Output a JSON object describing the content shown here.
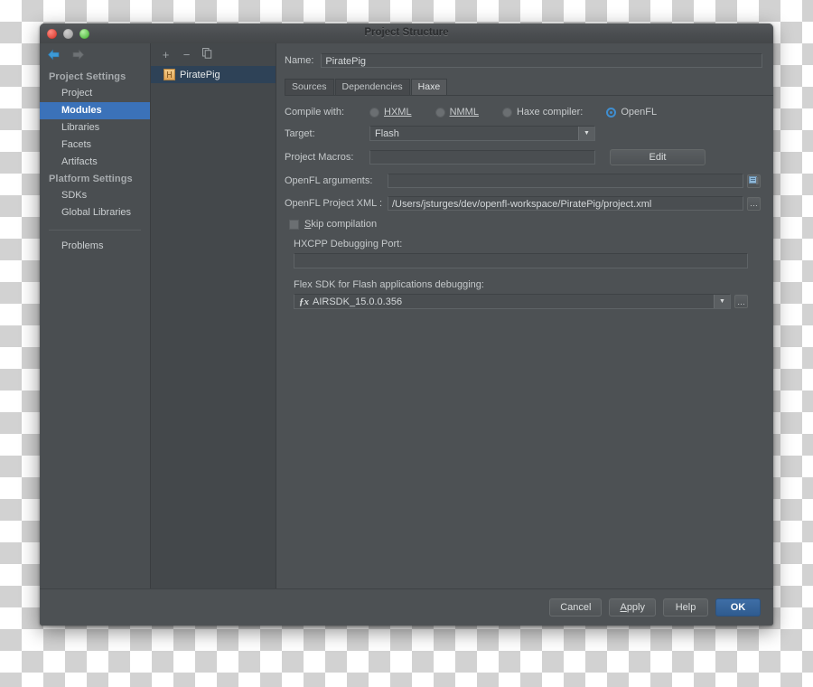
{
  "window": {
    "title": "Project Structure",
    "traffic_lights": [
      "close-red",
      "minimize-gray",
      "zoom-green"
    ]
  },
  "navigation": {
    "back_icon": "arrow-left-icon",
    "forward_icon": "arrow-right-icon"
  },
  "sidebar": {
    "groups": [
      {
        "label": "Project Settings",
        "items": [
          {
            "label": "Project",
            "selected": false
          },
          {
            "label": "Modules",
            "selected": true
          },
          {
            "label": "Libraries",
            "selected": false
          },
          {
            "label": "Facets",
            "selected": false
          },
          {
            "label": "Artifacts",
            "selected": false
          }
        ]
      },
      {
        "label": "Platform Settings",
        "items": [
          {
            "label": "SDKs",
            "selected": false
          },
          {
            "label": "Global Libraries",
            "selected": false
          }
        ]
      }
    ],
    "footer_items": [
      {
        "label": "Problems",
        "selected": false
      }
    ],
    "selected_color": "#3b72b9"
  },
  "module_pane": {
    "toolbar": {
      "add_label": "+",
      "remove_label": "−",
      "copy_label": "❐"
    },
    "modules": [
      {
        "name": "PiratePig",
        "selected": true
      }
    ]
  },
  "editor": {
    "name_label": "Name:",
    "name_value": "PiratePig",
    "tabs": [
      {
        "label": "Sources",
        "active": false
      },
      {
        "label": "Dependencies",
        "active": false
      },
      {
        "label": "Haxe",
        "active": true
      }
    ],
    "compile_with": {
      "label": "Compile with:",
      "options": [
        {
          "label": "HXML",
          "mnemonic": "H",
          "selected": false
        },
        {
          "label": "NMML",
          "mnemonic": "N",
          "selected": false
        },
        {
          "label": "Haxe compiler:",
          "mnemonic": "",
          "selected": false
        },
        {
          "label": "OpenFL",
          "mnemonic": "",
          "selected": true
        }
      ]
    },
    "target": {
      "label": "Target:",
      "value": "Flash",
      "arrow_icon": "chevron-down-icon"
    },
    "project_macros": {
      "label": "Project Macros:",
      "value": "",
      "edit_button": "Edit"
    },
    "openfl_arguments": {
      "label": "OpenFL arguments:",
      "value": "",
      "expand_icon": "expand-editor-icon"
    },
    "openfl_project_xml": {
      "label": "OpenFL Project XML :",
      "value": "/Users/jsturges/dev/openfl-workspace/PiratePig/project.xml",
      "browse_label": "…"
    },
    "skip_compilation": {
      "label": "Skip compilation",
      "mnemonic": "S",
      "checked": false
    },
    "hxcpp_port": {
      "label": "HXCPP Debugging Port:",
      "value": ""
    },
    "flex_sdk": {
      "label": "Flex SDK for Flash applications debugging:",
      "value": "AIRSDK_15.0.0.356",
      "icon": "fx-icon",
      "arrow_icon": "chevron-down-icon",
      "browse_label": "…"
    }
  },
  "footer": {
    "buttons": [
      {
        "label": "Cancel",
        "default": false
      },
      {
        "label": "Apply",
        "mnemonic": "A",
        "default": false
      },
      {
        "label": "Help",
        "default": false
      },
      {
        "label": "OK",
        "default": true
      }
    ]
  }
}
